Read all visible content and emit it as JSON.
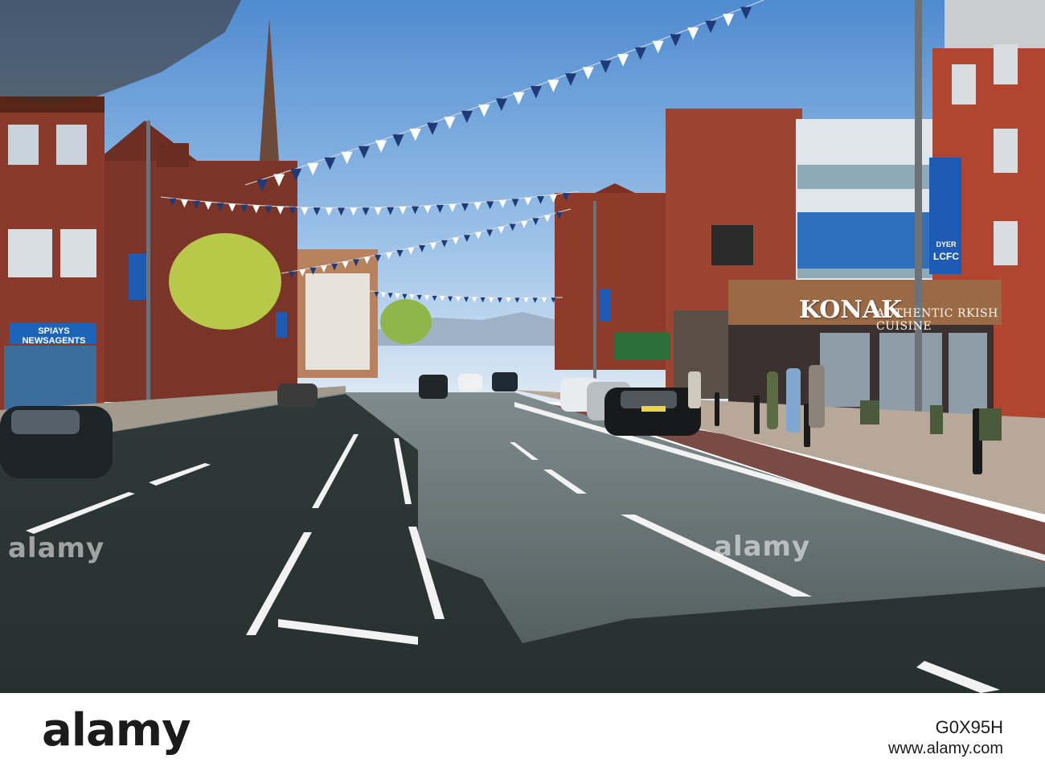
{
  "scene": {
    "description_colors": {
      "sky_top": "#5b92d2",
      "sky_bottom": "#cfe2f3",
      "road": "#5e6a6b",
      "road_shadow": "#27302f",
      "brick": "#8a3a2a",
      "bunting_blue": "#1f3a78",
      "bunting_white": "#ffffff"
    }
  },
  "signs": {
    "restaurant_name": "KONAK",
    "restaurant_cuisine": "AUTHENTIC  RKISH CUISINE",
    "banner_right_line1": "DYER",
    "banner_right_line2": "LCFC",
    "left_shop_sign": "SPIAYS NEWSAGENTS"
  },
  "watermarks": {
    "left": "alamy",
    "right": "alamy"
  },
  "footer": {
    "logo": "alamy",
    "image_code": "G0X95H",
    "url": "www.alamy.com"
  }
}
